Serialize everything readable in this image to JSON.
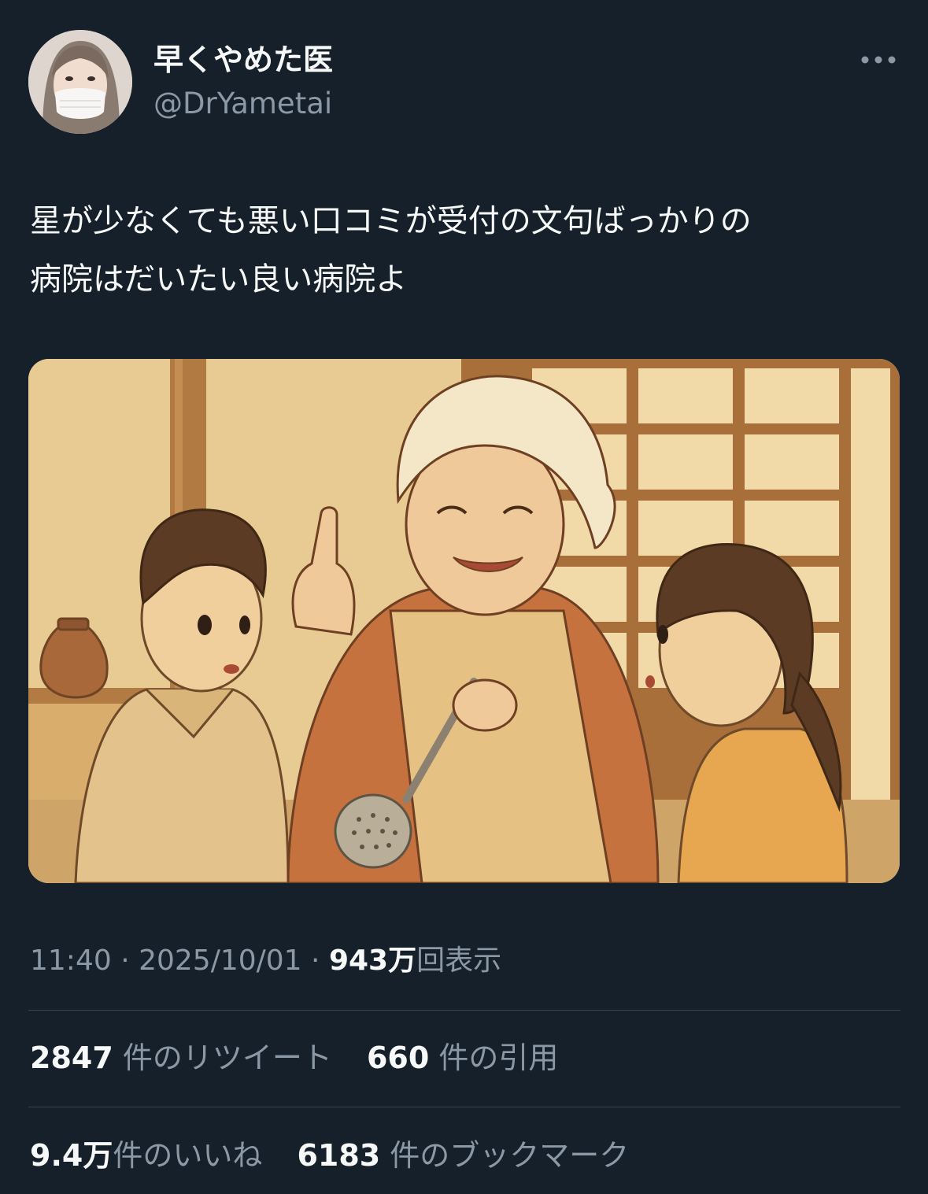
{
  "user": {
    "display_name": "早くやめた医",
    "handle": "@DrYametai",
    "avatar": "profile-photo-masked-woman"
  },
  "more_icon": "more-horizontal-icon",
  "tweet": {
    "text": "星が少なくても悪い口コミが受付の文句ばっかりの\n病院はだいたい良い病院よ",
    "image": "illustration-grandmother-with-two-children"
  },
  "meta": {
    "time": "11:40",
    "sep1": " · ",
    "date": "2025/10/01",
    "sep2": " · ",
    "views_count": "943万",
    "views_label": "回表示"
  },
  "stats": {
    "retweets_count": "2847",
    "retweets_label": "件のリツイート",
    "quotes_count": "660",
    "quotes_label": "件の引用",
    "likes_count": "9.4万",
    "likes_label": "件のいいね",
    "bookmarks_count": "6183",
    "bookmarks_label": "件のブックマーク"
  },
  "colors": {
    "background": "#15202b",
    "text_primary": "#f7f9f9",
    "text_secondary": "#8b98a5",
    "divider": "#38444d"
  }
}
